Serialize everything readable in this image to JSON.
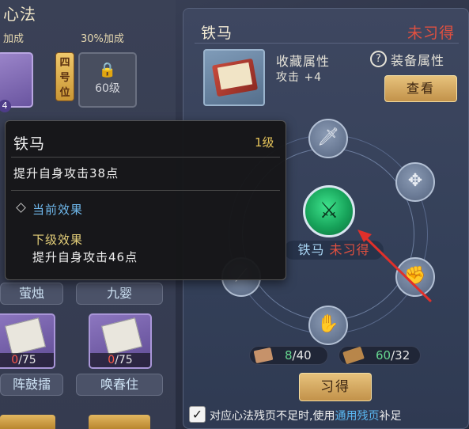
{
  "left": {
    "title": "心法",
    "bonus_left": "加成",
    "bonus_right": "30%加成",
    "slot_tag": "4",
    "slot_label": "四号位",
    "locked_level": "60级",
    "pills_top": [
      "萤烛",
      "九婴"
    ],
    "cards": [
      {
        "current": "0",
        "total": "/75"
      },
      {
        "current": "0",
        "total": "/75"
      }
    ],
    "pills_bottom": [
      "阵鼓擂",
      "唤春住"
    ]
  },
  "detail": {
    "skill_name": "铁马",
    "status": "未习得",
    "collect_label": "收藏属性",
    "attack_stat": "攻击 +4",
    "help_glyph": "?",
    "equip_label": "装备属性",
    "view_button": "查看"
  },
  "wheel": {
    "active_name": "铁马",
    "active_status": "未习得",
    "node_icons": [
      "sword-icon",
      "cross-icon",
      "fist-icon",
      "palm-icon",
      "spear-icon",
      "active-skill-icon"
    ]
  },
  "resources": {
    "pages_current": "8",
    "pages_total": "/40",
    "general_current": "60",
    "general_total": "/32",
    "learn_button": "习得"
  },
  "autofill": {
    "checked": "✓",
    "text_before": "对应心法残页不足时,使用",
    "text_highlight": "通用残页",
    "text_after": "补足"
  },
  "tooltip": {
    "name": "铁马",
    "level": "1级",
    "desc": "提升自身攻击38点",
    "current_label": "当前效果",
    "next_label": "下级效果",
    "next_desc": "提升自身攻击46点"
  },
  "colors": {
    "status_red": "#e05040",
    "gold_button": "#e7c27c",
    "highlight_blue": "#5ab8f2",
    "level_gold": "#e6c45a"
  }
}
